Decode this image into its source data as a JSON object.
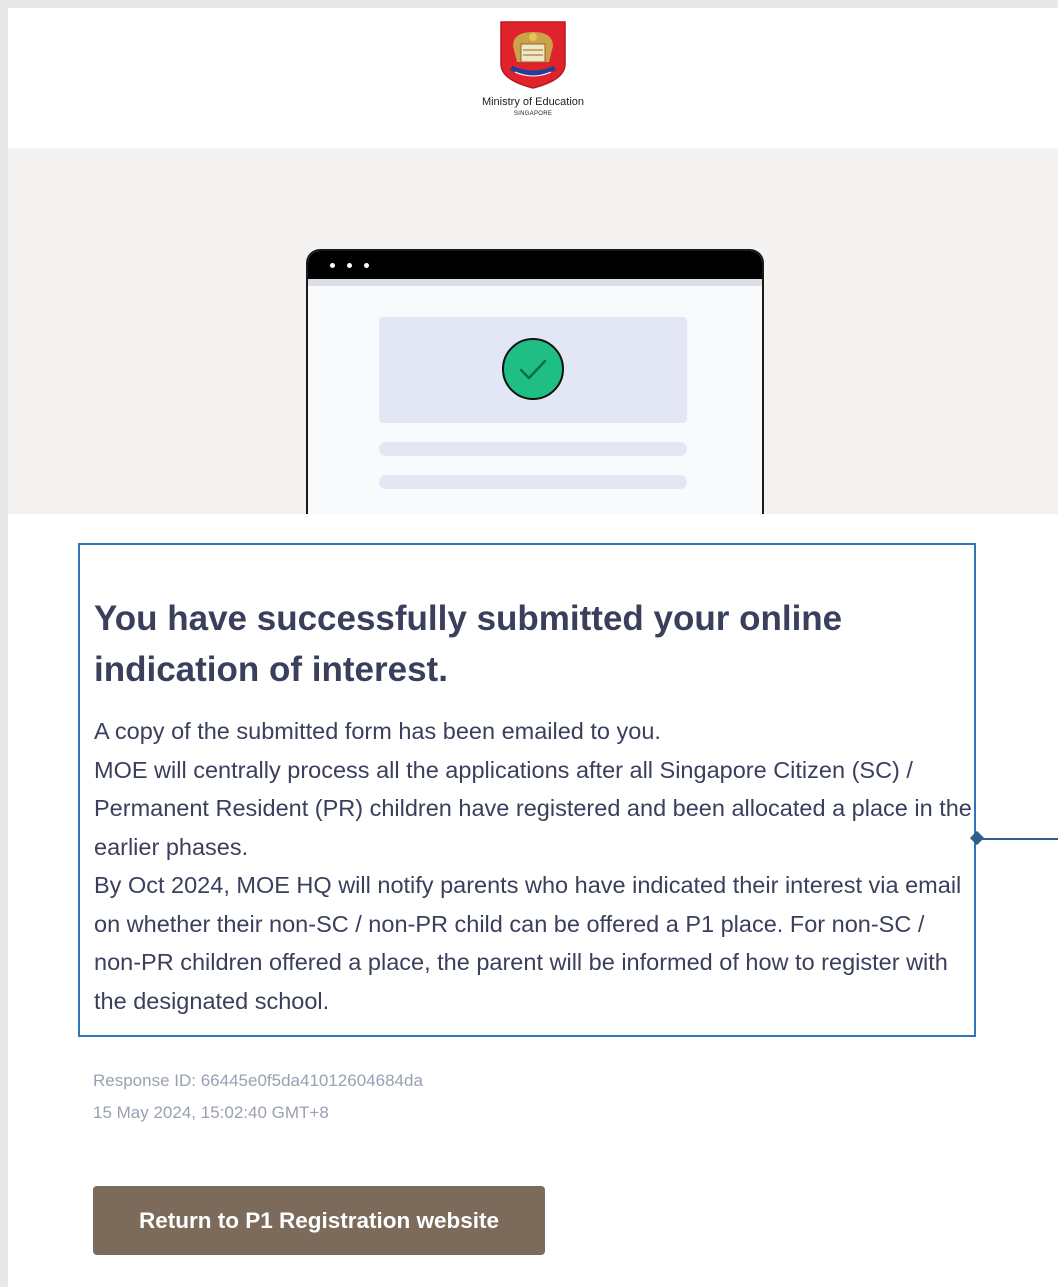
{
  "header": {
    "agency_name": "Ministry of Education",
    "agency_subtitle": "SINGAPORE",
    "logo_icon": "moe-crest-icon"
  },
  "illustration": {
    "icon": "success-check-icon",
    "accent_color": "#1fbe84"
  },
  "message": {
    "title": "You have successfully submitted your online indication of interest.",
    "paragraphs": [
      "A copy of the submitted form has been emailed to you.",
      "MOE will centrally process all the applications after all Singapore Citizen (SC) / Permanent Resident (PR) children have registered and been allocated a place in the earlier phases.",
      "By Oct 2024, MOE HQ will notify parents who have indicated their interest via email on whether their non-SC / non-PR child can be offered a P1 place. For non-SC / non-PR children offered a place, the parent will be informed of how to register with the designated school."
    ],
    "highlight_color": "#2f76b8"
  },
  "response": {
    "id_text": "Response ID: 66445e0f5da41012604684da",
    "timestamp": "15 May 2024, 15:02:40 GMT+8"
  },
  "actions": {
    "return_label": "Return to P1 Registration website",
    "return_color": "#7c6b5b"
  }
}
